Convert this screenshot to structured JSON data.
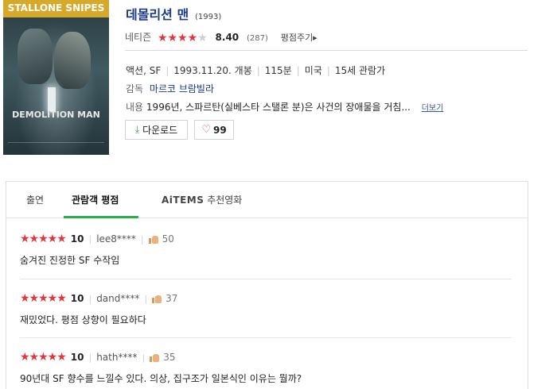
{
  "poster": {
    "top_text": "STALLONE  SNIPES",
    "title_text": "DEMOLITION MAN"
  },
  "movie": {
    "title": "데몰리션 맨",
    "year": "(1993)",
    "rating_source": "네티즌",
    "rating_score": "8.40",
    "rating_count": "(287)",
    "rating_stars": 4,
    "rating_stars_total": 5,
    "rate_link": "평점주기▸",
    "genre": "액션, SF",
    "release": "1993.11.20. 개봉",
    "runtime": "115분",
    "country": "미국",
    "age_rating": "15세 관람가",
    "director_label": "감독",
    "director": "마르코 브람빌라",
    "summary_label": "내용",
    "summary": "1996년, 스파르탄(실베스타 스탤론 분)은 사건의 장애물을 거침...",
    "more_link": "더보기",
    "download_label": "다운로드",
    "like_count": "99"
  },
  "tabs": {
    "cast": "출연",
    "reviews": "관람객 평점",
    "aitems_brand": "AiTEMS",
    "aitems_rest": " 추천영화"
  },
  "reviews": [
    {
      "stars": "★★★★★",
      "score": "10",
      "user": "lee8****",
      "likes": "50",
      "text": "숨겨진 진정한 SF 수작임"
    },
    {
      "stars": "★★★★★",
      "score": "10",
      "user": "dand****",
      "likes": "37",
      "text": "재밌었다. 평점 상향이 필요하다"
    },
    {
      "stars": "★★★★★",
      "score": "10",
      "user": "hath****",
      "likes": "35",
      "text": "90년대 SF 향수를 느낄수 있다. 의상, 집구조가 일본식인 이유는 뭘까?"
    }
  ],
  "colors": {
    "title_blue": "#1a3a8a",
    "star_red": "#e2363b",
    "tab_green": "#27b04a"
  }
}
